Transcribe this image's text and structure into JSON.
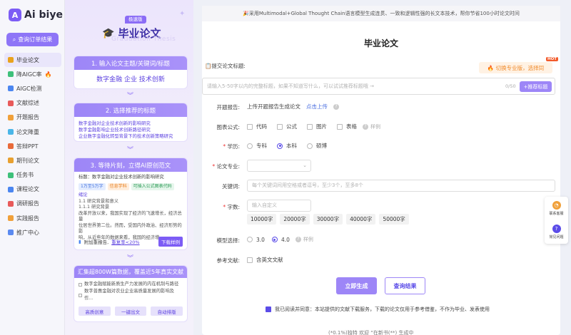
{
  "app": {
    "logo_mark": "A",
    "name": "Ai biye"
  },
  "sidebar": {
    "query_label": "查询订单结果",
    "items": [
      {
        "label": "毕业论文",
        "color": "#e9a21c",
        "active": true
      },
      {
        "label": "降AIGC率",
        "color": "#3ec07a",
        "fire": "🔥"
      },
      {
        "label": "AIGC检测",
        "color": "#4b86f0"
      },
      {
        "label": "文献综述",
        "color": "#e85a5a"
      },
      {
        "label": "开题报告",
        "color": "#f0a03a"
      },
      {
        "label": "论文降重",
        "color": "#4bb6e8"
      },
      {
        "label": "答辩PPT",
        "color": "#e86a3a"
      },
      {
        "label": "期刊论文",
        "color": "#e8a030"
      },
      {
        "label": "任务书",
        "color": "#3ec07a"
      },
      {
        "label": "课程论文",
        "color": "#4b86f0"
      },
      {
        "label": "调研报告",
        "color": "#e85a5a"
      },
      {
        "label": "实践报告",
        "color": "#f0a03a"
      },
      {
        "label": "推广中心",
        "color": "#5b8af0"
      }
    ]
  },
  "steps": {
    "badge": "极速版",
    "title": "毕业论文",
    "ghost": "Graduation Thesis",
    "step1": {
      "head": "1. 输入论文主题/关键词/标题",
      "keywords": "数字金融 企业 技术创新"
    },
    "step2": {
      "head": "2. 选择推荐的标题",
      "lines": [
        "数字金融对企业技术创新的影响研究",
        "数字金融影响企业技术创新路径研究",
        "企业数字金融化转型背景下的技术创新策略研究"
      ]
    },
    "step3": {
      "head": "3. 等待片刻，立得AI原创范文",
      "title_line": "标题：数字金融对企业技术创新的影响研究",
      "tags": [
        "1万至5万字",
        "信息学科",
        "可插入公式图表代码"
      ],
      "lines": [
        "绪论",
        "1.1 研究背景和意义",
        "1.1.1 研究背景",
        "改革开放以来，我国实现了经济的飞速增长，经济总量",
        "位居世界第二位。然而，受国内外政治、经济形势的影",
        "响，从近些年的数据来看，我国的经济增..."
      ],
      "foot_text": "附加重报告,",
      "foot_link": "重复率<20%",
      "download": "下载样例"
    },
    "step4": {
      "head": "汇集超800W篇数据，覆盖近5年真实文献",
      "items": [
        "数字金融赋能新质生产力发展的内在机制与路径",
        "数字普惠金融对农业企业高质量发展的影响及作..."
      ],
      "buttons": [
        "高质创意",
        "一键出文",
        "自动排版"
      ]
    }
  },
  "main": {
    "announcement": "🎉采用Multimodal+Global Thought Chain语言模型生成连贯、一致和逻辑性强的长文本技术，帮你节省100小时论文时间",
    "title": "毕业论文",
    "submit_label": "📋提交论文标题:",
    "hot": "HOT",
    "switch_label": "🔥 切换专业版，选择同",
    "title_placeholder": "请输入5-50字以内的完整标题，如果不知道写什么，可以试试推荐标题哦 →",
    "title_count": "0/50",
    "recommend_label": "+推荐标题",
    "proposal": {
      "label": "开题报告:",
      "text": "上传开题报告生成论文",
      "link": "点击上传"
    },
    "charts": {
      "label": "图表公式:",
      "options": [
        "代码",
        "公式",
        "图片",
        "表格"
      ],
      "example": "样例"
    },
    "degree": {
      "label": "学历:",
      "options": [
        "专科",
        "本科",
        "硕博"
      ]
    },
    "major": {
      "label": "论文专业:",
      "arrow": "⌄"
    },
    "keywords": {
      "label": "关键词:",
      "placeholder": "每个关键词间用空格或者逗号，至少3个，至多8个"
    },
    "words": {
      "label": "字数:",
      "placeholder": "输入自定义",
      "chips": [
        "10000字",
        "20000字",
        "30000字",
        "40000字",
        "50000字"
      ]
    },
    "model": {
      "label": "模型选择:",
      "options": [
        "3.0",
        "4.0"
      ],
      "example": "样例"
    },
    "refs": {
      "label": "参考文献:",
      "option": "含英文文献"
    },
    "generate": "立即生成",
    "query": "查询结果",
    "agreement": "我已阅读并同意：本站提供的文献下载服务，下载的论文仅用于参考借鉴，不作为毕业、发表使用",
    "bottom_text": "(*0.1%)独特 欢迎 “在新书(**) 生成中"
  },
  "floating": {
    "items": [
      "联系客服",
      "常见问题"
    ]
  },
  "colors": {
    "accent": "#9d86f7",
    "accent_dark": "#5b4ce8",
    "hot": "#f35a2a"
  }
}
